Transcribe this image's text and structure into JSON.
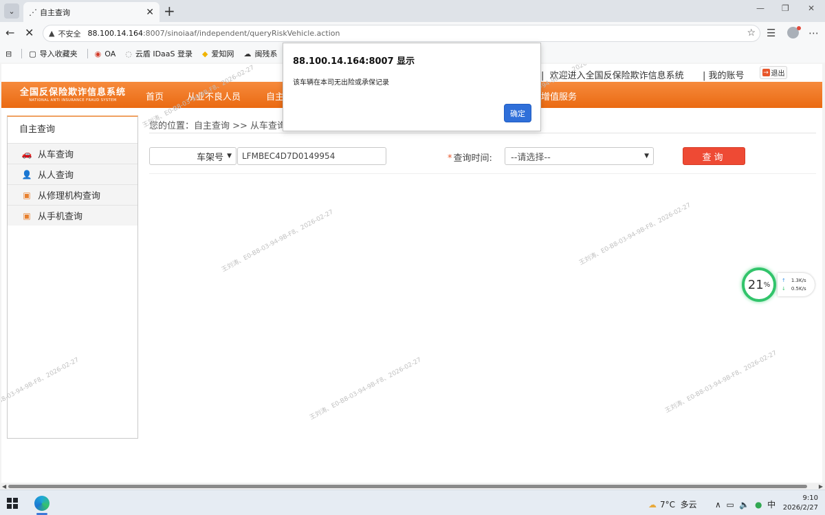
{
  "browser": {
    "tab_title": "自主查询",
    "tab_favicon": "⋰",
    "url_warning": "不安全",
    "url_host": "88.100.14.164",
    "url_path": ":8007/sinoiaaf/independent/queryRiskVehicle.action",
    "bookmarks": [
      {
        "icon": "▢",
        "label": "导入收藏夹"
      },
      {
        "icon": "◉",
        "label": "OA"
      },
      {
        "icon": "◌",
        "label": "云盾 IDaaS 登录"
      },
      {
        "icon": "◆",
        "label": "爱知网"
      },
      {
        "icon": "☁",
        "label": "闽残系"
      }
    ]
  },
  "site": {
    "welcome": "欢迎进入全国反保险欺诈信息系统",
    "my_account": "我的账号",
    "logout": "退出",
    "logo_cn": "全国反保险欺诈信息系统",
    "logo_en": "NATIONAL ANTI INSURANCE FRAUD SYSTEM",
    "menu": [
      "首页",
      "从业不良人员",
      "自主",
      "增值服务"
    ]
  },
  "sidebar": {
    "header": "自主查询",
    "items": [
      {
        "icon": "car-icon",
        "label": "从车查询"
      },
      {
        "icon": "person-icon",
        "label": "从人查询"
      },
      {
        "icon": "building-icon",
        "label": "从修理机构查询"
      },
      {
        "icon": "phone-icon",
        "label": "从手机查询"
      }
    ]
  },
  "main": {
    "breadcrumb": "您的位置：自主查询 >> 从车查询",
    "type_select_value": "车架号",
    "vin_value": "LFMBEC4D7D0149954",
    "required_mark": "*",
    "time_label": "查询时间:",
    "time_select_value": "--请选择--",
    "query_button": "查询"
  },
  "watermark_text": "王刘涛、E0-B8-03-94-9B-F8、2026-02-27",
  "net_widget": {
    "percent": "21",
    "percent_sign": "%",
    "up": "1.3K/s",
    "down": "0.5K/s"
  },
  "dialog": {
    "title": "88.100.14.164:8007 显示",
    "message": "该车辆在本司无出险或承保记录",
    "ok_button": "确定"
  },
  "taskbar": {
    "weather_temp": "7°C",
    "weather_desc": "多云",
    "ime": "中",
    "time": "9:10",
    "date": "2026/2/27"
  },
  "colors": {
    "accent_orange": "#ee6b1a",
    "query_red": "#ee4a34",
    "dialog_blue": "#2f6fd9"
  }
}
